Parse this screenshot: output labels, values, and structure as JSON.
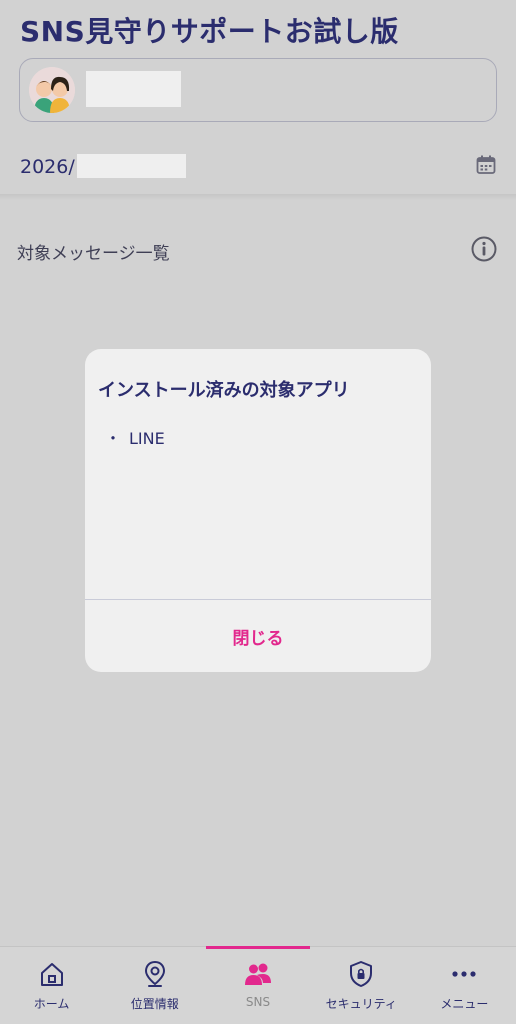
{
  "header": {
    "title": "SNS見守りサポートお試し版"
  },
  "date": {
    "text": "2026/"
  },
  "section": {
    "label": "対象メッセージ一覧"
  },
  "modal": {
    "title": "インストール済みの対象アプリ",
    "items": [
      {
        "bullet": "・",
        "label": "LINE"
      }
    ],
    "close_label": "閉じる"
  },
  "tabs": [
    {
      "label": "ホーム",
      "icon": "home-icon"
    },
    {
      "label": "位置情報",
      "icon": "location-pin-icon"
    },
    {
      "label": "SNS",
      "icon": "people-icon",
      "active": true
    },
    {
      "label": "セキュリティ",
      "icon": "shield-lock-icon"
    },
    {
      "label": "メニュー",
      "icon": "more-dots-icon"
    }
  ],
  "colors": {
    "accent": "#e2288d",
    "navy": "#2b2d6e"
  }
}
